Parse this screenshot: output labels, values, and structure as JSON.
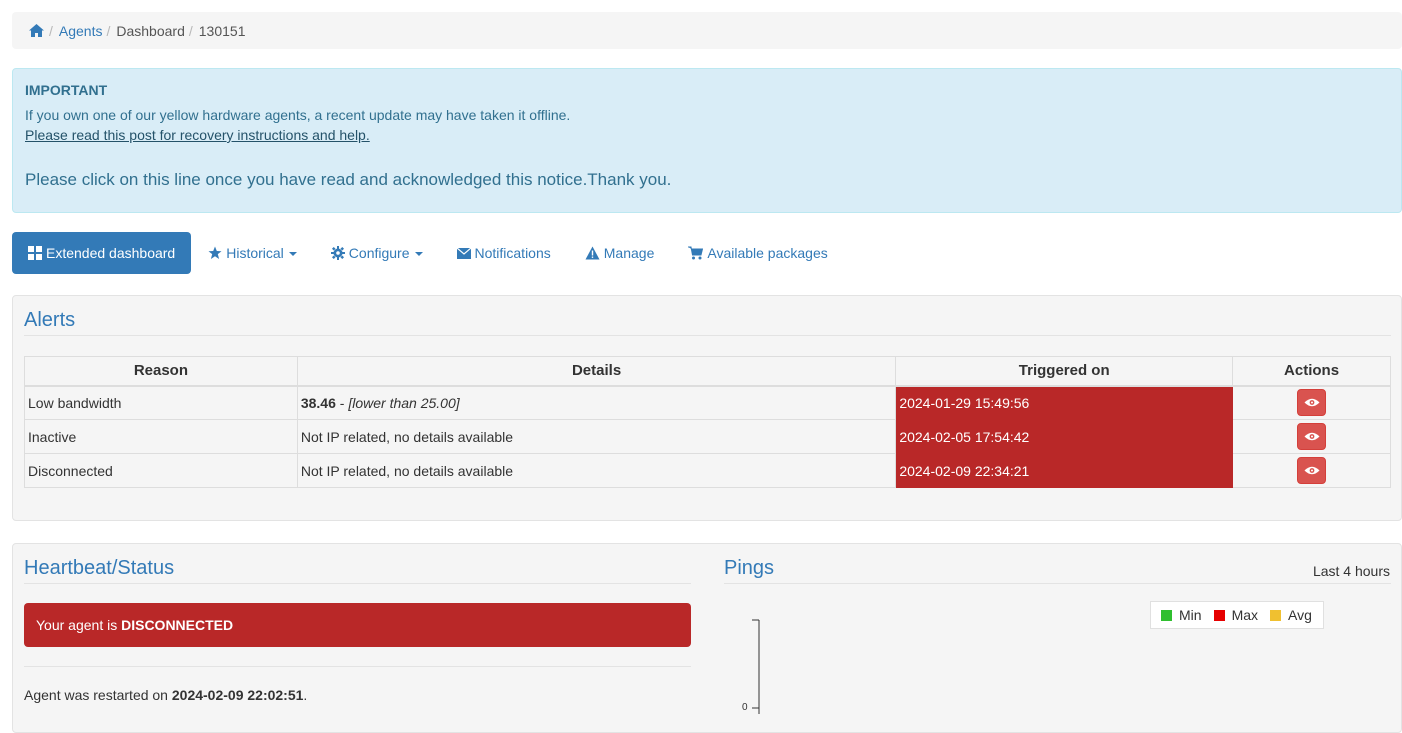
{
  "breadcrumb": {
    "items": [
      "Agents",
      "Dashboard",
      "130151"
    ]
  },
  "notice": {
    "title": "IMPORTANT",
    "line1": "If you own one of our yellow hardware agents, a recent update may have taken it offline.",
    "link": "Please read this post for recovery instructions and help.",
    "ack": "Please click on this line once you have read and acknowledged this notice.Thank you."
  },
  "nav": {
    "extended": "Extended dashboard",
    "historical": "Historical",
    "configure": "Configure",
    "notifications": "Notifications",
    "manage": "Manage",
    "packages": "Available packages"
  },
  "alerts": {
    "title": "Alerts",
    "columns": [
      "Reason",
      "Details",
      "Triggered on",
      "Actions"
    ],
    "rows": [
      {
        "reason": "Low bandwidth",
        "detail_value": "38.46",
        "detail_sep": " - ",
        "detail_note": "[lower than 25.00]",
        "triggered": "2024-01-29 15:49:56"
      },
      {
        "reason": "Inactive",
        "detail_value": "",
        "detail_sep": "",
        "detail_note": "Not IP related, no details available",
        "triggered": "2024-02-05 17:54:42"
      },
      {
        "reason": "Disconnected",
        "detail_value": "",
        "detail_sep": "",
        "detail_note": "Not IP related, no details available",
        "triggered": "2024-02-09 22:34:21"
      }
    ]
  },
  "heartbeat": {
    "title": "Heartbeat/Status",
    "status_prefix": "Your agent is ",
    "status_value": "DISCONNECTED",
    "restart_prefix": "Agent was restarted on ",
    "restart_value": "2024-02-09 22:02:51",
    "restart_suffix": "."
  },
  "pings": {
    "title": "Pings",
    "range": "Last 4 hours",
    "legend": [
      {
        "name": "Min",
        "color": "#2fbf2f"
      },
      {
        "name": "Max",
        "color": "#e60000"
      },
      {
        "name": "Avg",
        "color": "#f0c030"
      }
    ],
    "y_tick": "0"
  },
  "colors": {
    "accent": "#337ab7",
    "danger": "#b92828",
    "info_bg": "#d9edf7"
  }
}
